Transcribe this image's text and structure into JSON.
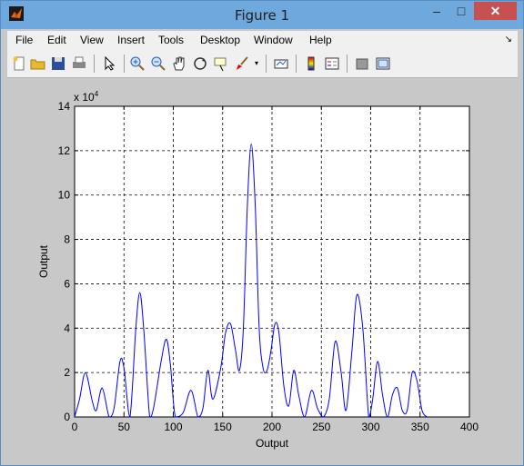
{
  "window": {
    "title": "Figure 1",
    "minimize_glyph": "–",
    "maximize_glyph": "□",
    "close_glyph": "✕"
  },
  "menu": [
    "File",
    "Edit",
    "View",
    "Insert",
    "Tools",
    "Desktop",
    "Window",
    "Help"
  ],
  "toolbar_icons": [
    "new-figure-icon",
    "open-folder-icon",
    "save-icon",
    "print-icon",
    "select-arrow-icon",
    "zoom-in-icon",
    "zoom-out-icon",
    "pan-hand-icon",
    "rotate-3d-icon",
    "data-cursor-icon",
    "brush-icon",
    "brush-dropdown-icon",
    "link-plot-icon",
    "colorbar-icon",
    "legend-icon",
    "hide-plot-tools-icon",
    "show-plot-tools-icon"
  ],
  "colors": {
    "title_bar": "#6fa8dc",
    "close_button": "#c75050",
    "figure_background": "#c8c8c8",
    "line": "#0000ff"
  },
  "chart_data": {
    "type": "line",
    "xlabel": "Output",
    "ylabel": "Output",
    "xlim": [
      0,
      400
    ],
    "ylim": [
      0,
      140000
    ],
    "xticks": [
      0,
      50,
      100,
      150,
      200,
      250,
      300,
      350,
      400
    ],
    "yticks": [
      0,
      20000,
      40000,
      60000,
      80000,
      100000,
      120000,
      140000
    ],
    "xtick_labels": [
      "0",
      "50",
      "100",
      "150",
      "200",
      "250",
      "300",
      "350",
      "400"
    ],
    "ytick_labels": [
      "0",
      "2",
      "4",
      "6",
      "8",
      "10",
      "12",
      "14"
    ],
    "exponent_label": "x 10",
    "exponent_power": "4",
    "grid": true,
    "series": [
      {
        "x": [
          0,
          5,
          11,
          18,
          22,
          28,
          35,
          40,
          46,
          50,
          56,
          62,
          66,
          70,
          76,
          80,
          88,
          93,
          97,
          102,
          110,
          118,
          125,
          130,
          135,
          140,
          148,
          153,
          158,
          163,
          167,
          171,
          175,
          179,
          183,
          187,
          191,
          195,
          199,
          203,
          207,
          212,
          217,
          222,
          227,
          233,
          240,
          246,
          252,
          258,
          264,
          270,
          275,
          281,
          286,
          292,
          298,
          302,
          307,
          312,
          317,
          322,
          327,
          332,
          337,
          342,
          347,
          352,
          357
        ],
        "y": [
          0,
          8000,
          20000,
          7000,
          3000,
          13000,
          0,
          4000,
          25000,
          22000,
          0,
          40000,
          56000,
          40000,
          0,
          4000,
          26000,
          35000,
          24000,
          0,
          2000,
          12000,
          0,
          4000,
          21000,
          8000,
          22000,
          38000,
          42000,
          30000,
          21000,
          40000,
          95000,
          123000,
          95000,
          40000,
          22000,
          21000,
          30000,
          42000,
          38000,
          14000,
          5000,
          21000,
          10000,
          0,
          12000,
          4000,
          0,
          8000,
          34000,
          20000,
          3000,
          30000,
          55000,
          40000,
          0,
          8000,
          25000,
          10000,
          0,
          10000,
          13000,
          3000,
          3000,
          20000,
          16000,
          3000,
          0
        ]
      }
    ]
  }
}
